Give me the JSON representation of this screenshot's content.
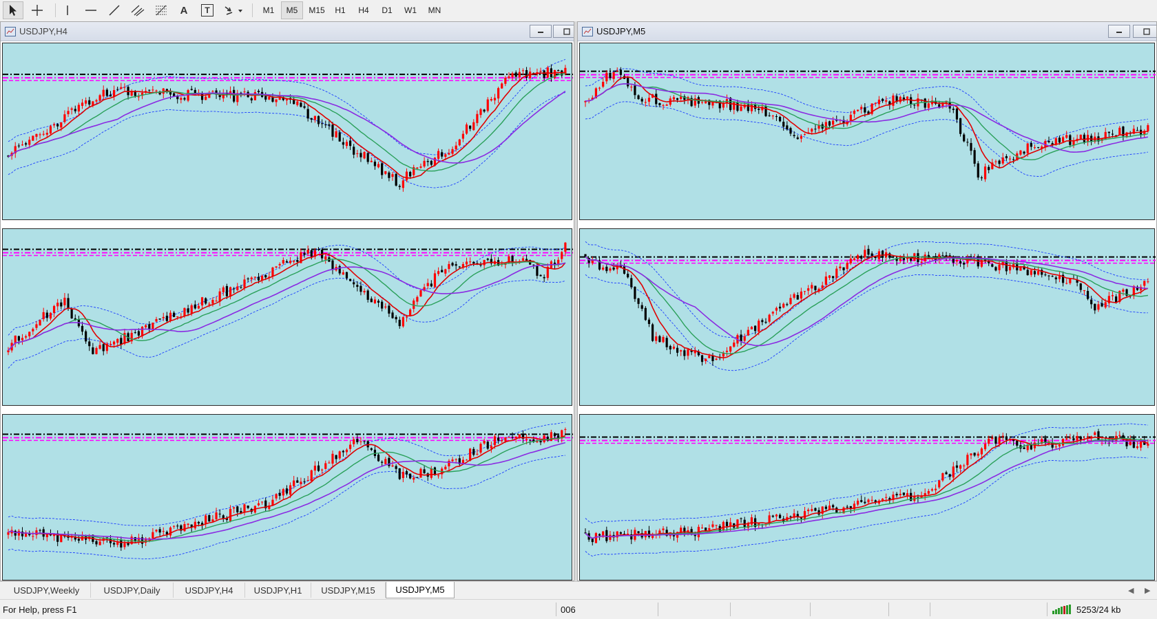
{
  "toolbar": {
    "tools": [
      {
        "name": "cursor-tool-icon"
      },
      {
        "name": "crosshair-tool-icon"
      },
      {
        "name": "vertical-line-tool-icon"
      },
      {
        "name": "horizontal-line-tool-icon"
      },
      {
        "name": "trend-line-tool-icon"
      },
      {
        "name": "equidistant-channel-tool-icon"
      },
      {
        "name": "fibonacci-tool-icon"
      },
      {
        "name": "text-tool-icon",
        "label": "A"
      },
      {
        "name": "text-label-tool-icon",
        "label": "T"
      },
      {
        "name": "arrows-tool-icon"
      }
    ],
    "timeframes": [
      "M1",
      "M5",
      "M15",
      "H1",
      "H4",
      "D1",
      "W1",
      "MN"
    ],
    "active_timeframe": "M5"
  },
  "windows": [
    {
      "title": "USDJPY,H4",
      "active": false
    },
    {
      "title": "USDJPY,M5",
      "active": true
    }
  ],
  "chart_colors": {
    "background": "#b0e0e6",
    "bull_candle": "#ff0000",
    "bear_candle": "#000000",
    "ma_fast": "#e00000",
    "ma_mid": "#2aa05a",
    "ma_slow": "#8a2be2",
    "bands": "#1a3cff",
    "level_black": "#000000",
    "level_magenta": "#ff00ff"
  },
  "tabs": {
    "items": [
      "USDJPY,Weekly",
      "USDJPY,Daily",
      "USDJPY,H4",
      "USDJPY,H1",
      "USDJPY,M15",
      "USDJPY,M5"
    ],
    "active": "USDJPY,M5"
  },
  "status": {
    "help": "For Help, press F1",
    "profile": "006",
    "traffic": "5253/24 kb"
  }
}
